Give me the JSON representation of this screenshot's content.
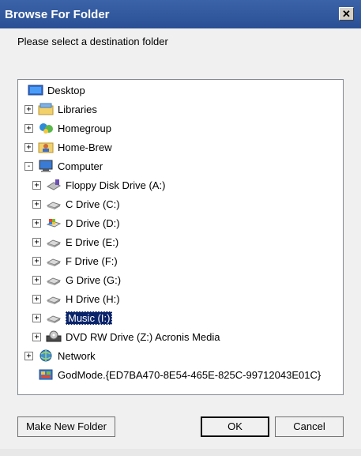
{
  "window": {
    "title": "Browse For Folder",
    "close_glyph": "✕"
  },
  "prompt": "Please select a destination folder",
  "tree": [
    {
      "label": "Desktop",
      "icon": "desktop-icon",
      "expander": "none",
      "indent": 0
    },
    {
      "label": "Libraries",
      "icon": "libraries-icon",
      "expander": "+",
      "indent": 1
    },
    {
      "label": "Homegroup",
      "icon": "homegroup-icon",
      "expander": "+",
      "indent": 1
    },
    {
      "label": "Home-Brew",
      "icon": "user-folder-icon",
      "expander": "+",
      "indent": 1
    },
    {
      "label": "Computer",
      "icon": "computer-icon",
      "expander": "-",
      "indent": 1
    },
    {
      "label": "Floppy Disk Drive (A:)",
      "icon": "floppy-icon",
      "expander": "+",
      "indent": 2
    },
    {
      "label": "C Drive (C:)",
      "icon": "drive-icon",
      "expander": "+",
      "indent": 2
    },
    {
      "label": "D Drive (D:)",
      "icon": "system-drive-icon",
      "expander": "+",
      "indent": 2
    },
    {
      "label": "E Drive (E:)",
      "icon": "drive-icon",
      "expander": "+",
      "indent": 2
    },
    {
      "label": "F Drive (F:)",
      "icon": "drive-icon",
      "expander": "+",
      "indent": 2
    },
    {
      "label": "G Drive (G:)",
      "icon": "drive-icon",
      "expander": "+",
      "indent": 2
    },
    {
      "label": "H Drive (H:)",
      "icon": "drive-icon",
      "expander": "+",
      "indent": 2
    },
    {
      "label": "Music (I:)",
      "icon": "drive-icon",
      "expander": "+",
      "indent": 2,
      "selected": true
    },
    {
      "label": "DVD RW Drive (Z:) Acronis Media",
      "icon": "dvd-drive-icon",
      "expander": "+",
      "indent": 2
    },
    {
      "label": "Network",
      "icon": "network-icon",
      "expander": "+",
      "indent": 1
    },
    {
      "label": "GodMode.{ED7BA470-8E54-465E-825C-99712043E01C}",
      "icon": "control-panel-icon",
      "expander": "none",
      "indent": 1
    }
  ],
  "buttons": {
    "make_new_folder": "Make New Folder",
    "ok": "OK",
    "cancel": "Cancel"
  },
  "colors": {
    "titlebar": "#2a4f94",
    "selection": "#0a246a",
    "dialog": "#f0f0f0"
  }
}
